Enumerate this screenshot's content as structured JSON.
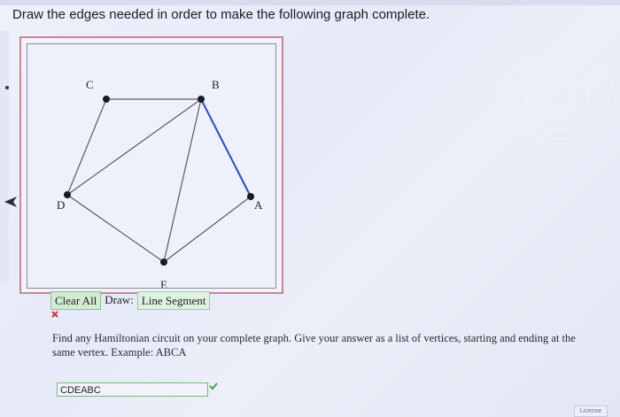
{
  "instruction": "Draw the edges needed in order to make the following graph complete.",
  "graph": {
    "vertices": [
      {
        "name": "C",
        "label": "C"
      },
      {
        "name": "B",
        "label": "B"
      },
      {
        "name": "D",
        "label": "D"
      },
      {
        "name": "A",
        "label": "A"
      },
      {
        "name": "E",
        "label": "E"
      }
    ],
    "edges": [
      {
        "from": "C",
        "to": "B",
        "color": "#5a5a66"
      },
      {
        "from": "C",
        "to": "D",
        "color": "#5a5a66"
      },
      {
        "from": "D",
        "to": "B",
        "color": "#5a5a66"
      },
      {
        "from": "B",
        "to": "A",
        "color": "#2a49d6"
      },
      {
        "from": "B",
        "to": "E",
        "color": "#5a5a66"
      },
      {
        "from": "D",
        "to": "E",
        "color": "#5a5a66"
      },
      {
        "from": "E",
        "to": "A",
        "color": "#5a5a66"
      }
    ]
  },
  "toolbar": {
    "clear_label": "Clear All",
    "draw_label": "Draw:",
    "tool_value": "Line Segment"
  },
  "status_mark": "x",
  "question": "Find any Hamiltonian circuit on your complete graph. Give your answer as a list of vertices, starting and ending at the same vertex. Example: ABCA",
  "answer": {
    "value": "CDEABC"
  },
  "license_label": "License",
  "colors": {
    "correct": "#3aa64a",
    "incorrect": "#d23434",
    "highlight_edge": "#2a49d6"
  }
}
